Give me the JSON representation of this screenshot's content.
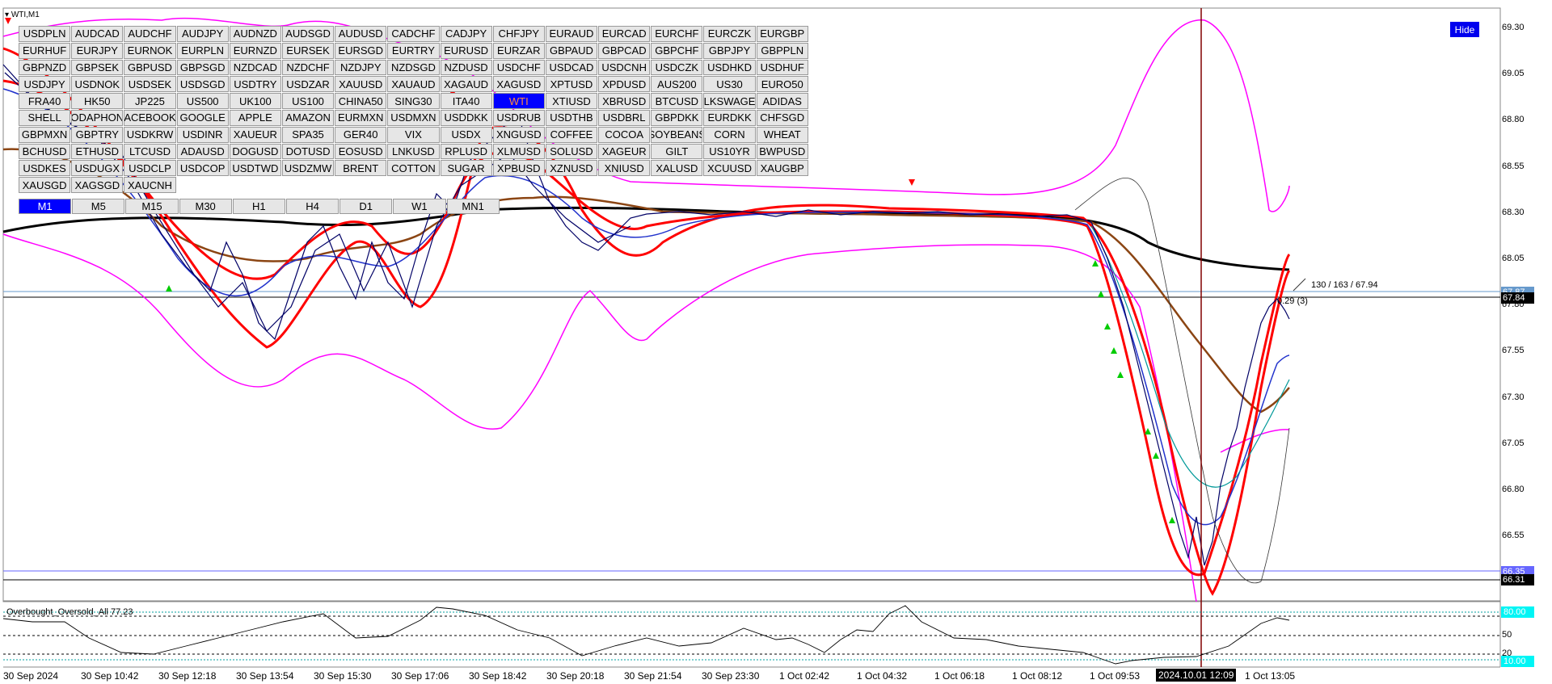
{
  "window": {
    "title": "WTI,M1"
  },
  "symbol_rows": [
    [
      "USDPLN",
      "AUDCAD",
      "AUDCHF",
      "AUDJPY",
      "AUDNZD",
      "AUDSGD",
      "AUDUSD",
      "CADCHF",
      "CADJPY",
      "CHFJPY",
      "EURAUD",
      "EURCAD",
      "EURCHF",
      "EURCZK",
      "EURGBP"
    ],
    [
      "EURHUF",
      "EURJPY",
      "EURNOK",
      "EURPLN",
      "EURNZD",
      "EURSEK",
      "EURSGD",
      "EURTRY",
      "EURUSD",
      "EURZAR",
      "GBPAUD",
      "GBPCAD",
      "GBPCHF",
      "GBPJPY",
      "GBPPLN"
    ],
    [
      "GBPNZD",
      "GBPSEK",
      "GBPUSD",
      "GBPSGD",
      "NZDCAD",
      "NZDCHF",
      "NZDJPY",
      "NZDSGD",
      "NZDUSD",
      "USDCHF",
      "USDCAD",
      "USDCNH",
      "USDCZK",
      "USDHKD",
      "USDHUF"
    ],
    [
      "USDJPY",
      "USDNOK",
      "USDSEK",
      "USDSGD",
      "USDTRY",
      "USDZAR",
      "XAUUSD",
      "XAUAUD",
      "XAGAUD",
      "XAGUSD",
      "XPTUSD",
      "XPDUSD",
      "AUS200",
      "US30",
      "EURO50"
    ],
    [
      "FRA40",
      "HK50",
      "JP225",
      "US500",
      "UK100",
      "US100",
      "CHINA50",
      "SING30",
      "ITA40",
      "WTI",
      "XTIUSD",
      "XBRUSD",
      "BTCUSD",
      "LKSWAGE",
      "ADIDAS"
    ],
    [
      "SHELL",
      "ODAPHON",
      "ACEBOOK",
      "GOOGLE",
      "APPLE",
      "AMAZON",
      "EURMXN",
      "USDMXN",
      "USDDKK",
      "USDRUB",
      "USDTHB",
      "USDBRL",
      "GBPDKK",
      "EURDKK",
      "CHFSGD"
    ],
    [
      "GBPMXN",
      "GBPTRY",
      "USDKRW",
      "USDINR",
      "XAUEUR",
      "SPA35",
      "GER40",
      "VIX",
      "USDX",
      "XNGUSD",
      "COFFEE",
      "COCOA",
      "SOYBEANS",
      "CORN",
      "WHEAT"
    ],
    [
      "BCHUSD",
      "ETHUSD",
      "LTCUSD",
      "ADAUSD",
      "DOGUSD",
      "DOTUSD",
      "EOSUSD",
      "LNKUSD",
      "RPLUSD",
      "XLMUSD",
      "SOLUSD",
      "XAGEUR",
      "GILT",
      "US10YR",
      "BWPUSD"
    ],
    [
      "USDKES",
      "USDUGX",
      "USDCLP",
      "USDCOP",
      "USDTWD",
      "USDZMW",
      "BRENT",
      "COTTON",
      "SUGAR",
      "XPBUSD",
      "XZNUSD",
      "XNIUSD",
      "XALUSD",
      "XCUUSD",
      "XAUGBP"
    ],
    [
      "XAUSGD",
      "XAGSGD",
      "XAUCNH"
    ]
  ],
  "active_symbol": "WTI",
  "timeframes": [
    "M1",
    "M5",
    "M15",
    "M30",
    "H1",
    "H4",
    "D1",
    "W1",
    "MN1"
  ],
  "active_timeframe": "M1",
  "hide_button": "Hide",
  "price_axis": [
    "69.30",
    "69.05",
    "68.80",
    "68.55",
    "68.30",
    "68.05",
    "67.80",
    "67.55",
    "67.30",
    "67.05",
    "66.80",
    "66.55"
  ],
  "price_tags": {
    "current": "67.84",
    "line_upper": "67.87",
    "low_blue": "66.35",
    "low": "66.31"
  },
  "info": {
    "fib_text": "130 / 163 / 67.94",
    "dist_text": "0.29 (3)"
  },
  "oscillator": {
    "label": "Overbought_Oversold_All 77.23",
    "ticks": [
      "50",
      "20"
    ],
    "upper_tag": "80.00",
    "lower_tag": "10.00"
  },
  "time_axis": [
    "30 Sep 2024",
    "30 Sep 10:42",
    "30 Sep 12:18",
    "30 Sep 13:54",
    "30 Sep 15:30",
    "30 Sep 17:06",
    "30 Sep 18:42",
    "30 Sep 20:18",
    "30 Sep 21:54",
    "30 Sep 23:30",
    "1 Oct 02:42",
    "1 Oct 04:32",
    "1 Oct 06:18",
    "1 Oct 08:12",
    "1 Oct 09:53",
    "1 Oct 13:05"
  ],
  "time_cursor": "2024.10.01 12:09",
  "colors": {
    "bollinger": "#ff00ff",
    "ma_fast": "#ff0000",
    "ma_slow": "#8b4513",
    "ma_long": "#000000",
    "price": "#000066",
    "cursor_line": "#800000",
    "signal_arrow": "#00cc00",
    "button_active": "#0000ff"
  },
  "chart_data": {
    "type": "line",
    "series": [
      {
        "values": [
          68.95,
          68.7,
          68.3,
          67.75,
          67.65,
          68.0,
          67.8,
          68.25,
          68.8,
          68.45,
          68.3,
          68.2,
          68.18,
          68.28,
          68.26,
          68.25,
          68.3,
          68.27,
          68.24,
          67.9,
          67.2,
          66.6,
          66.45,
          66.9,
          67.6,
          67.85
        ]
      }
    ],
    "ylim": [
      66.2,
      69.45
    ]
  }
}
